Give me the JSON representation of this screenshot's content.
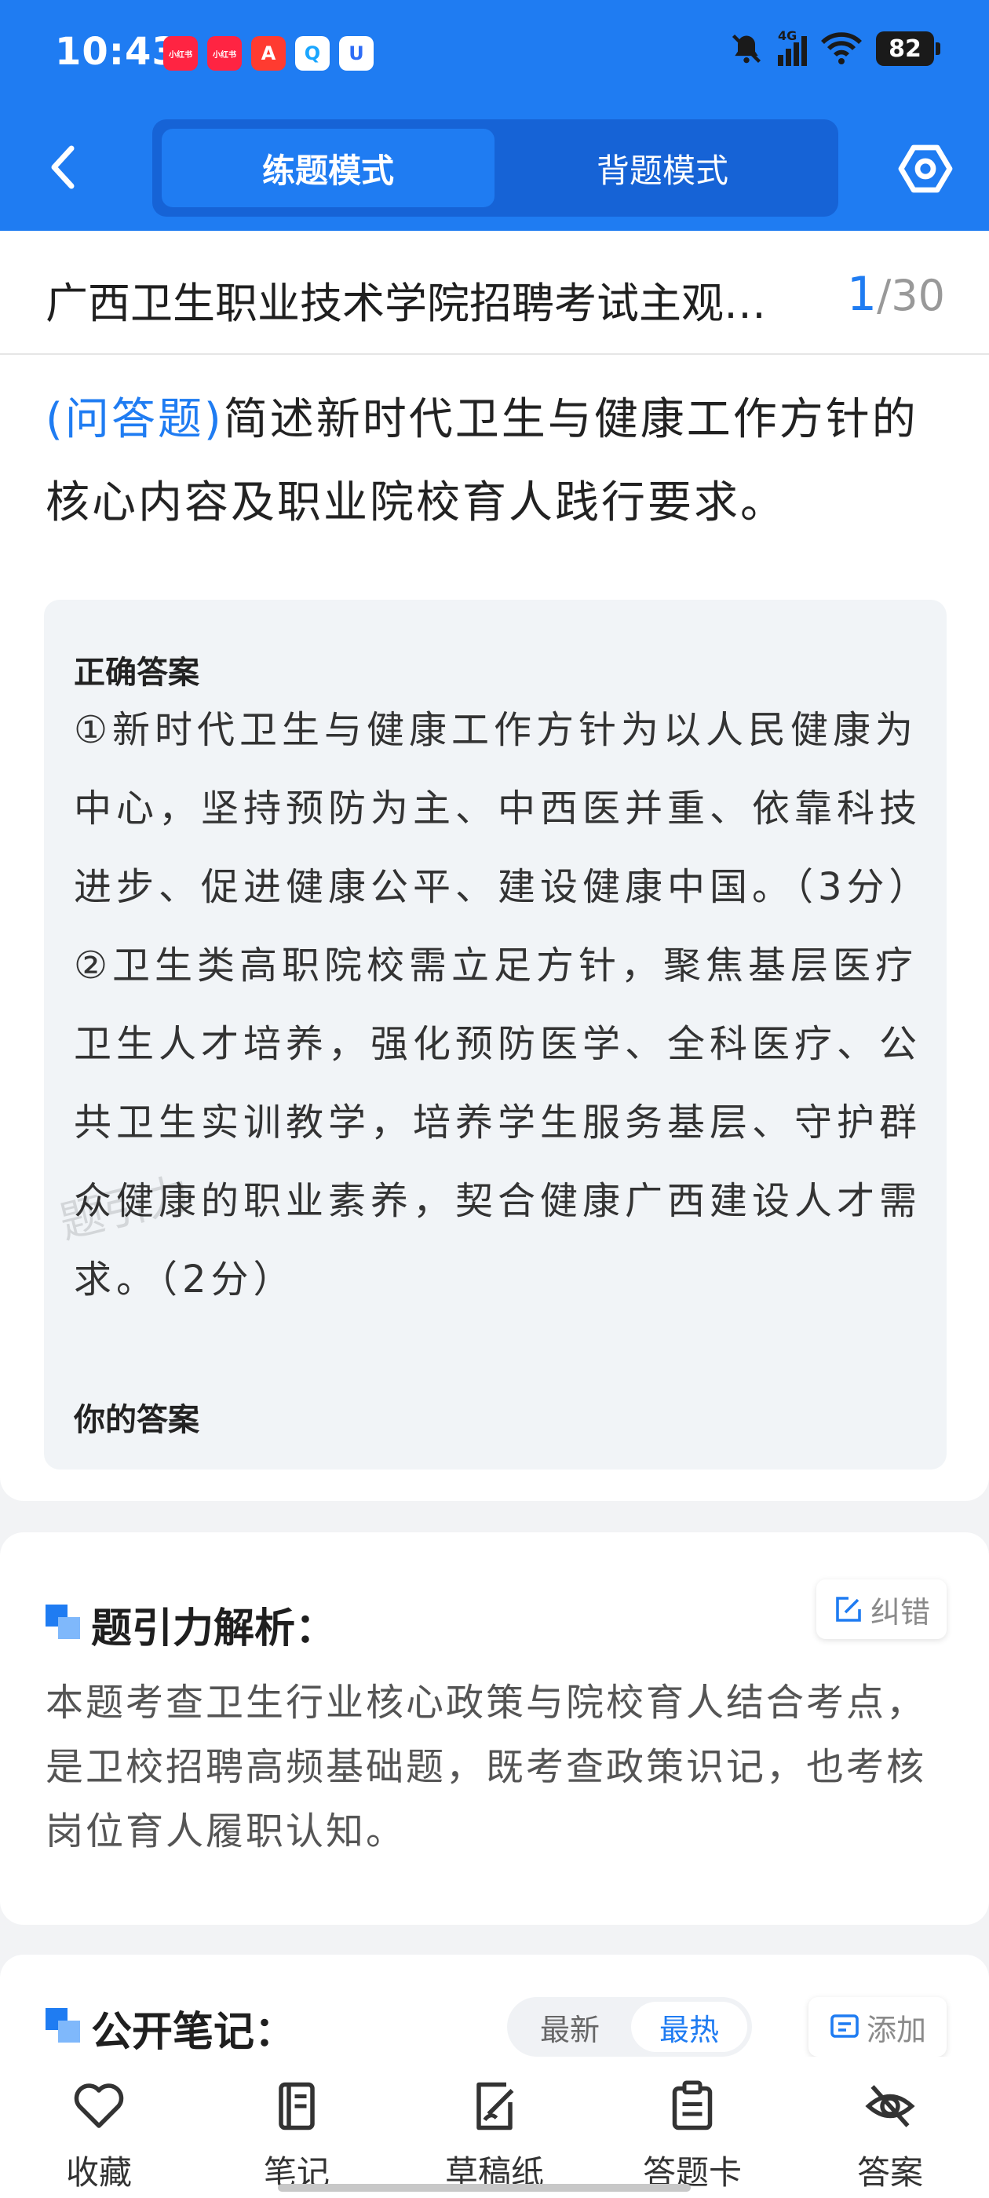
{
  "status_bar": {
    "time": "10:43",
    "battery": "82",
    "network": "4G",
    "app_icons": [
      {
        "name": "xiaohongshu-icon",
        "label": "小红书",
        "color": "#ff2442"
      },
      {
        "name": "xiaohongshu-icon-2",
        "label": "小红书",
        "color": "#ff2442"
      },
      {
        "name": "app-a-icon",
        "label": "A",
        "color": "#ff3b30"
      },
      {
        "name": "chat-app-icon",
        "label": "Q",
        "color": "#1aa6ff"
      },
      {
        "name": "app-u-icon",
        "label": "U",
        "color": "#2e6cf6"
      }
    ]
  },
  "header": {
    "back_icon": "chevron-left-icon",
    "modes": [
      "练题模式",
      "背题模式"
    ],
    "active_mode": "练题模式",
    "settings_icon": "hexagon-settings-icon"
  },
  "paper": {
    "title": "广西卫生职业技术学院招聘考试主观…",
    "current": "1",
    "separator": "/",
    "total": "30"
  },
  "question": {
    "type": "(问答题)",
    "text": "简述新时代卫生与健康工作方针的核心内容及职业院校育人践行要求。"
  },
  "answer": {
    "correct_label": "正确答案",
    "correct_text": "①新时代卫生与健康工作方针为以人民健康为中心，坚持预防为主、中西医并重、依靠科技进步、促进健康公平、建设健康中国。（3分）②卫生类高职院校需立足方针，聚焦基层医疗卫生人才培养，强化预防医学、全科医疗、公共卫生实训教学，培养学生服务基层、守护群众健康的职业素养，契合健康广西建设人才需求。（2分）",
    "watermark": "题引力",
    "your_label": "你的答案"
  },
  "analysis": {
    "title": "题引力解析：",
    "report_label": "纠错",
    "text": "本题考查卫生行业核心政策与院校育人结合考点，是卫校招聘高频基础题，既考查政策识记，也考核岗位育人履职认知。"
  },
  "notes": {
    "title": "公开笔记：",
    "sort_options": [
      "最新",
      "最热"
    ],
    "active_sort": "最热",
    "add_label": "添加"
  },
  "bottom_nav": [
    {
      "label": "收藏",
      "icon": "heart-icon"
    },
    {
      "label": "笔记",
      "icon": "notebook-icon"
    },
    {
      "label": "草稿纸",
      "icon": "draft-pen-icon"
    },
    {
      "label": "答题卡",
      "icon": "answer-sheet-icon"
    },
    {
      "label": "答案",
      "icon": "eye-off-icon"
    }
  ],
  "colors": {
    "primary": "#1f7cf2",
    "primary_dark": "#1663d6"
  }
}
